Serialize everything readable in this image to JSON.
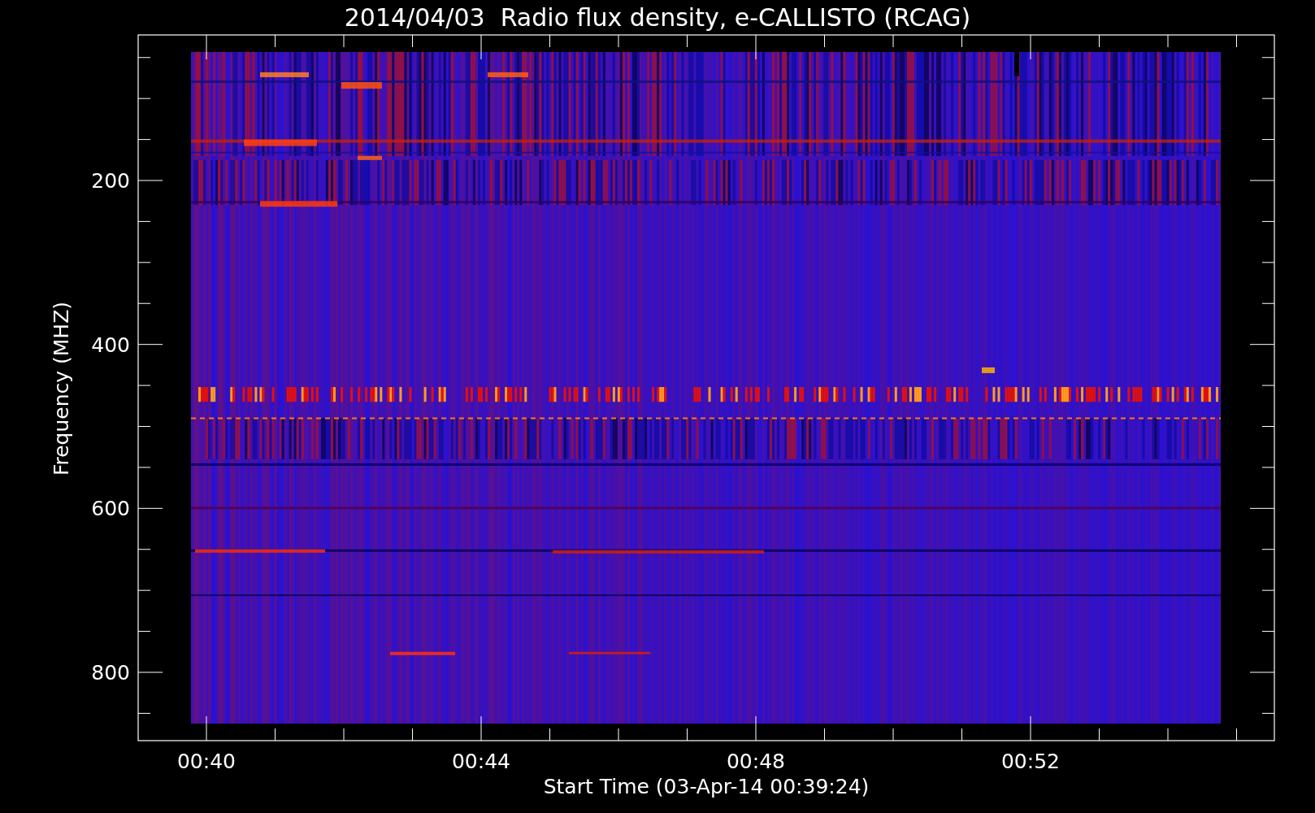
{
  "title": "2014/04/03  Radio flux density, e-CALLISTO (RCAG)",
  "y_axis": {
    "label": "Frequency (MHZ)",
    "tick_labels": [
      "200",
      "400",
      "600",
      "800"
    ]
  },
  "x_axis": {
    "label": "Start Time (03-Apr-14 00:39:24)",
    "tick_labels": [
      "00:40",
      "00:44",
      "00:48",
      "00:52"
    ]
  }
}
